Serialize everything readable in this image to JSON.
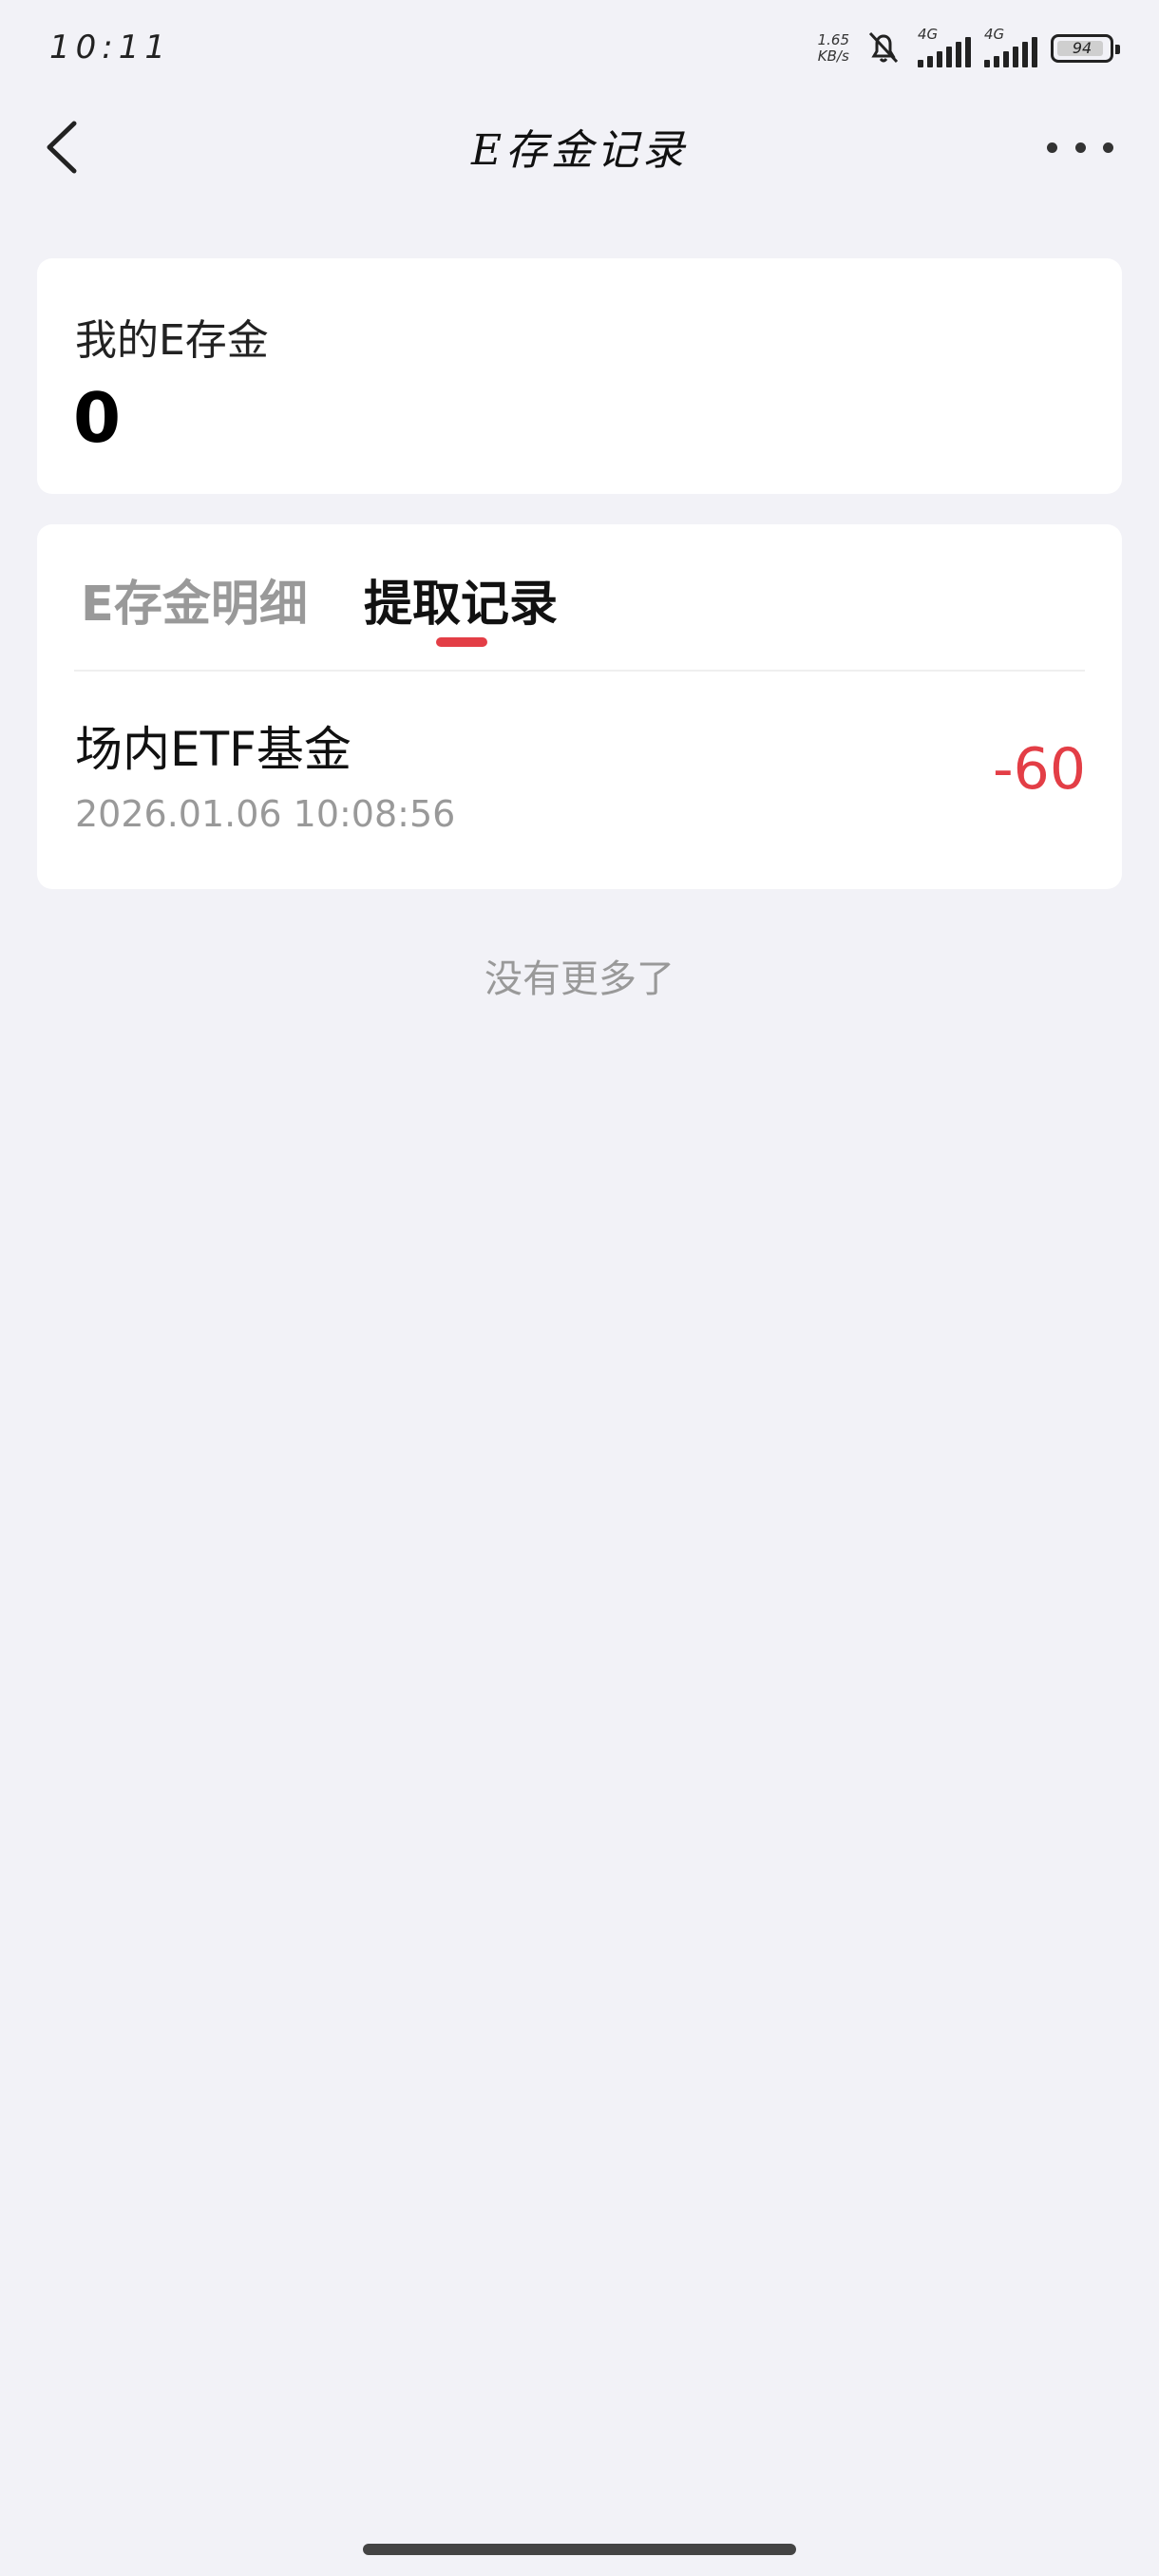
{
  "status_bar": {
    "time": "10:11",
    "net_speed_value": "1.65",
    "net_speed_unit": "KB/s",
    "sim1_label": "4G",
    "sim2_label": "4G",
    "battery": "94"
  },
  "nav": {
    "title": "E存金记录"
  },
  "balance": {
    "label": "我的E存金",
    "value": "0"
  },
  "tabs": [
    {
      "label": "E存金明细",
      "active": false
    },
    {
      "label": "提取记录",
      "active": true
    }
  ],
  "records": [
    {
      "title": "场内ETF基金",
      "time": "2026.01.06 10:08:56",
      "amount": "-60"
    }
  ],
  "footer": {
    "no_more": "没有更多了"
  },
  "colors": {
    "accent": "#e33e46",
    "background": "#f2f2f7"
  }
}
